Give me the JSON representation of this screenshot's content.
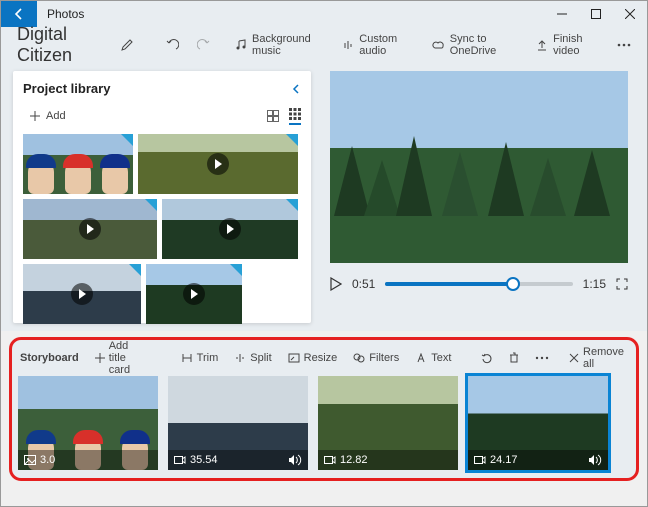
{
  "window": {
    "title": "Photos"
  },
  "project": {
    "title": "Digital Citizen"
  },
  "toolbar": {
    "bg_music": "Background music",
    "custom_audio": "Custom audio",
    "sync": "Sync to OneDrive",
    "finish": "Finish video"
  },
  "library": {
    "heading": "Project library",
    "add_label": "Add"
  },
  "player": {
    "current": "0:51",
    "total": "1:15"
  },
  "storyboard": {
    "title": "Storyboard",
    "add_title_card": "Add title card",
    "trim": "Trim",
    "split": "Split",
    "resize": "Resize",
    "filters": "Filters",
    "text": "Text",
    "remove_all": "Remove all",
    "clips": [
      {
        "duration": "3.0",
        "has_audio": false,
        "selected": false,
        "type": "photo"
      },
      {
        "duration": "35.54",
        "has_audio": true,
        "selected": false,
        "type": "video"
      },
      {
        "duration": "12.82",
        "has_audio": false,
        "selected": false,
        "type": "video"
      },
      {
        "duration": "24.17",
        "has_audio": true,
        "selected": true,
        "type": "video"
      }
    ]
  }
}
